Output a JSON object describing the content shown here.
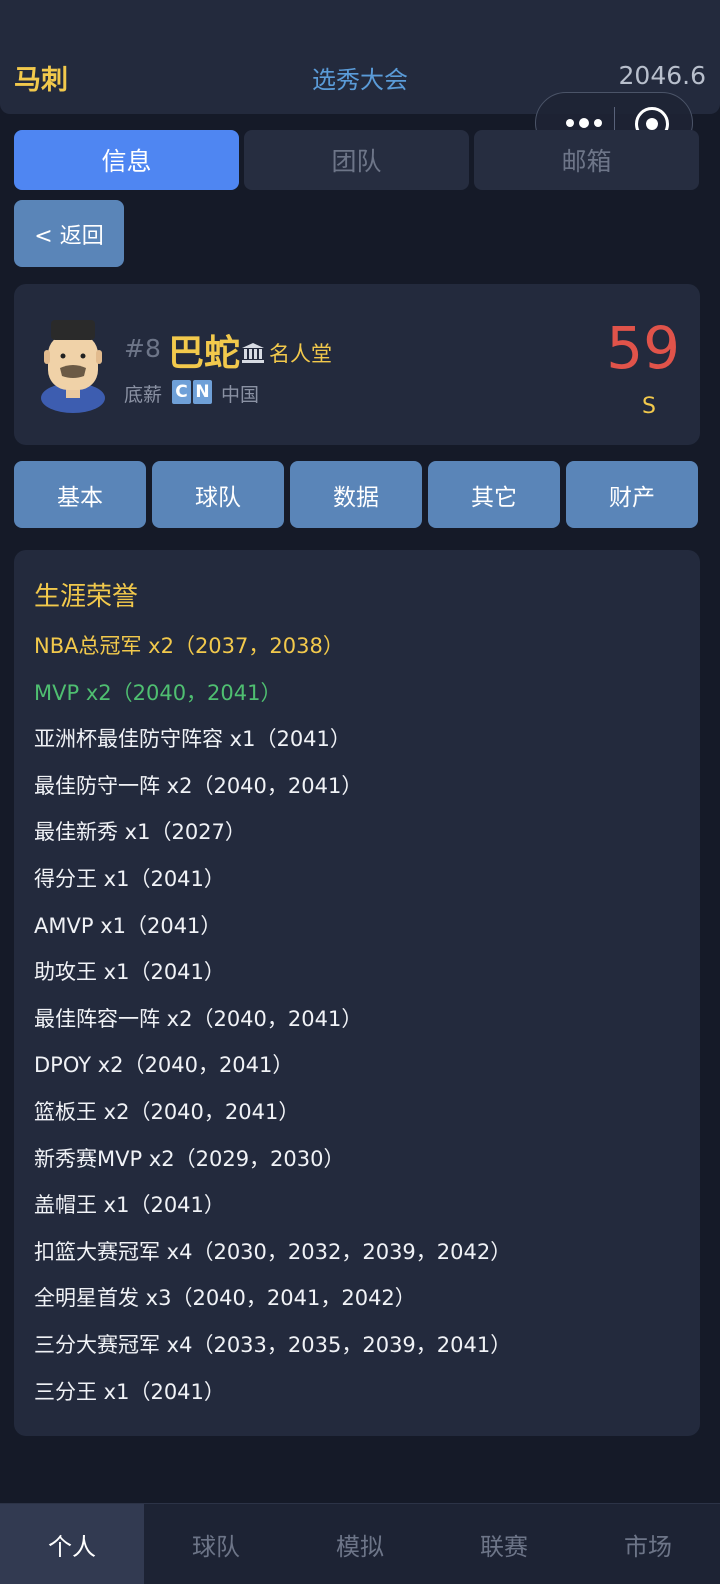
{
  "header": {
    "team_name": "马刺",
    "title": "选秀大会",
    "game_date": "2046.6"
  },
  "main_tabs": [
    {
      "label": "信息",
      "active": true
    },
    {
      "label": "团队",
      "active": false
    },
    {
      "label": "邮箱",
      "active": false
    }
  ],
  "back_button": "< 返回",
  "player": {
    "number": "#8",
    "name": "巴蛇",
    "hall_of_fame": "名人堂",
    "salary_label": "底薪",
    "country_code": [
      "C",
      "N"
    ],
    "country": "中国",
    "rating": "59",
    "grade": "S"
  },
  "detail_tabs": [
    "基本",
    "球队",
    "数据",
    "其它",
    "财产"
  ],
  "honors": {
    "title": "生涯荣誉",
    "items": [
      {
        "text": "NBA总冠军 x2（2037，2038）",
        "style": "gold"
      },
      {
        "text": "MVP x2（2040，2041）",
        "style": "green"
      },
      {
        "text": "亚洲杯最佳防守阵容 x1（2041）",
        "style": "normal"
      },
      {
        "text": "最佳防守一阵 x2（2040，2041）",
        "style": "normal"
      },
      {
        "text": "最佳新秀 x1（2027）",
        "style": "normal"
      },
      {
        "text": "得分王 x1（2041）",
        "style": "normal"
      },
      {
        "text": "AMVP x1（2041）",
        "style": "normal"
      },
      {
        "text": "助攻王 x1（2041）",
        "style": "normal"
      },
      {
        "text": "最佳阵容一阵 x2（2040，2041）",
        "style": "normal"
      },
      {
        "text": "DPOY x2（2040，2041）",
        "style": "normal"
      },
      {
        "text": "篮板王 x2（2040，2041）",
        "style": "normal"
      },
      {
        "text": "新秀赛MVP x2（2029，2030）",
        "style": "normal"
      },
      {
        "text": "盖帽王 x1（2041）",
        "style": "normal"
      },
      {
        "text": "扣篮大赛冠军 x4（2030，2032，2039，2042）",
        "style": "normal"
      },
      {
        "text": "全明星首发 x3（2040，2041，2042）",
        "style": "normal"
      },
      {
        "text": "三分大赛冠军 x4（2033，2035，2039，2041）",
        "style": "normal"
      },
      {
        "text": "三分王 x1（2041）",
        "style": "normal"
      }
    ]
  },
  "bottom_nav": [
    {
      "label": "个人",
      "active": true
    },
    {
      "label": "球队",
      "active": false
    },
    {
      "label": "模拟",
      "active": false
    },
    {
      "label": "联赛",
      "active": false
    },
    {
      "label": "市场",
      "active": false
    }
  ],
  "colors": {
    "accent_blue": "#4f86f2",
    "button_blue": "#5a85b8",
    "gold": "#f2c94c",
    "green": "#4fbf71",
    "rating_red": "#e0534a",
    "panel_bg": "#232a3d",
    "page_bg": "#151a28"
  },
  "icons": [
    "more-dots-icon",
    "target-icon",
    "hall-of-fame-icon",
    "player-avatar"
  ]
}
